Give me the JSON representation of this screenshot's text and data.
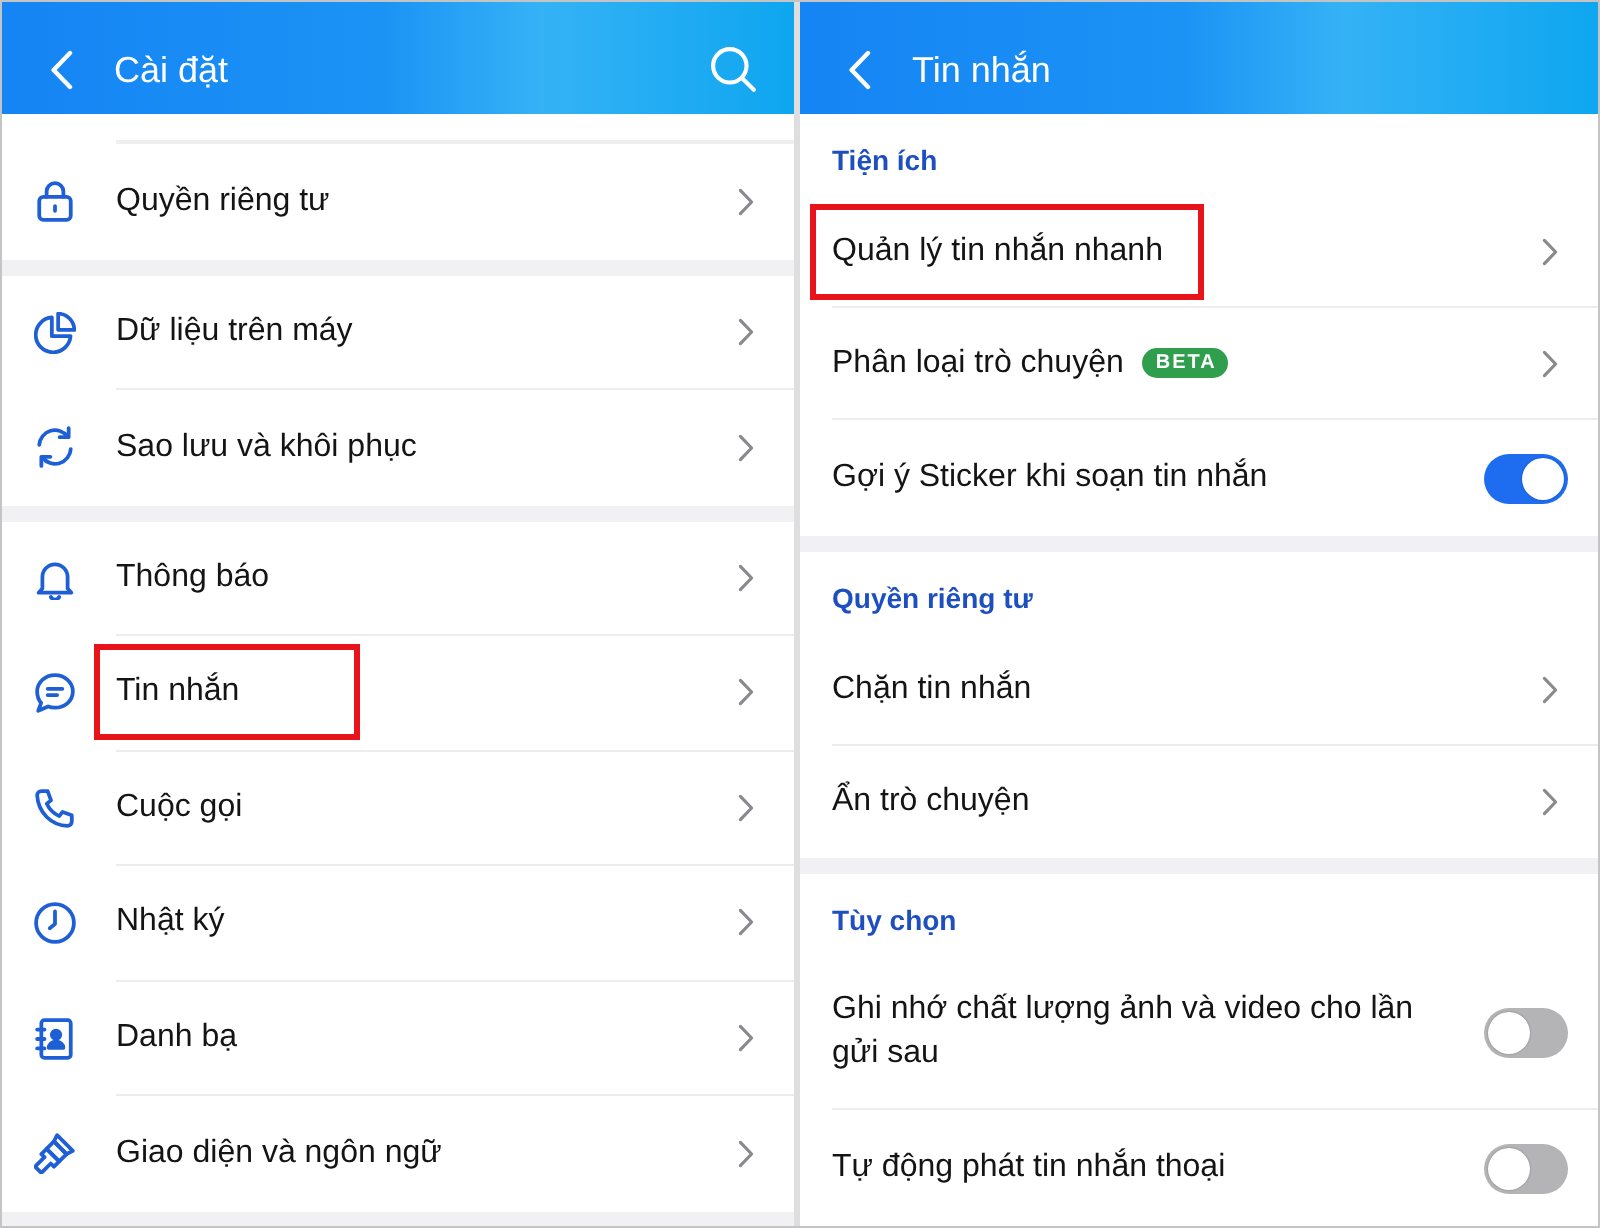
{
  "settings_screen": {
    "title": "Cài đặt",
    "groups": [
      {
        "items": [
          {
            "label": "Quyền riêng tư",
            "highlighted": false
          }
        ]
      },
      {
        "items": [
          {
            "label": "Dữ liệu trên máy",
            "highlighted": false
          },
          {
            "label": "Sao lưu và khôi phục",
            "highlighted": false
          }
        ]
      },
      {
        "items": [
          {
            "label": "Thông báo",
            "highlighted": false
          },
          {
            "label": "Tin nhắn",
            "highlighted": true
          },
          {
            "label": "Cuộc gọi",
            "highlighted": false
          },
          {
            "label": "Nhật ký",
            "highlighted": false
          },
          {
            "label": "Danh bạ",
            "highlighted": false
          },
          {
            "label": "Giao diện và ngôn ngữ",
            "highlighted": false
          }
        ]
      }
    ]
  },
  "messages_screen": {
    "title": "Tin nhắn",
    "sections": [
      {
        "heading": "Tiện ích",
        "items": [
          {
            "kind": "link",
            "label": "Quản lý tin nhắn nhanh",
            "highlighted": true
          },
          {
            "kind": "link",
            "label": "Phân loại trò chuyện",
            "badge": "BETA",
            "highlighted": false
          },
          {
            "kind": "toggle",
            "label": "Gợi ý Sticker khi soạn tin nhắn",
            "on": true,
            "highlighted": false
          }
        ]
      },
      {
        "heading": "Quyền riêng tư",
        "items": [
          {
            "kind": "link",
            "label": "Chặn tin nhắn",
            "highlighted": false
          },
          {
            "kind": "link",
            "label": "Ẩn trò chuyện",
            "highlighted": false
          }
        ]
      },
      {
        "heading": "Tùy chọn",
        "items": [
          {
            "kind": "toggle",
            "label": "Ghi nhớ chất lượng ảnh và video cho lần gửi sau",
            "on": false,
            "highlighted": false
          },
          {
            "kind": "toggle",
            "label": "Tự động phát tin nhắn thoại",
            "on": false,
            "highlighted": false
          }
        ]
      }
    ]
  }
}
